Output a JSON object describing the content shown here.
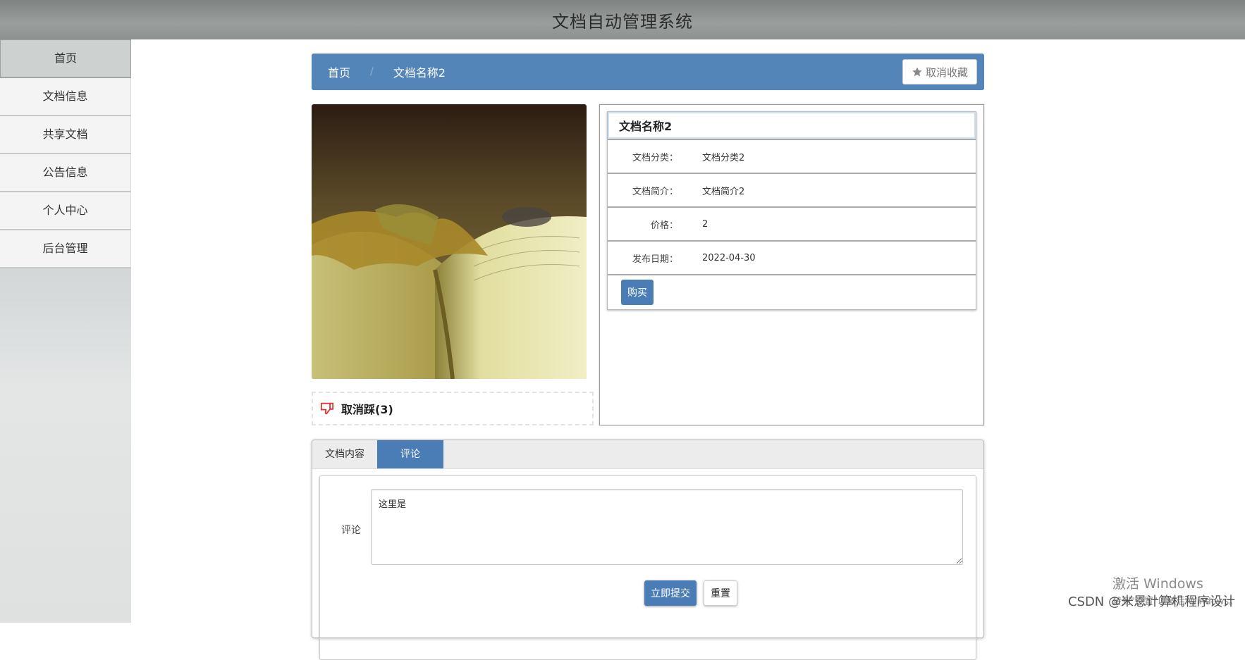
{
  "header": {
    "title": "文档自动管理系统"
  },
  "sidebar": {
    "items": [
      {
        "label": "首页"
      },
      {
        "label": "文档信息"
      },
      {
        "label": "共享文档"
      },
      {
        "label": "公告信息"
      },
      {
        "label": "个人中心"
      },
      {
        "label": "后台管理"
      }
    ]
  },
  "breadcrumb": {
    "home": "首页",
    "separator": "/",
    "current": "文档名称2",
    "unfavorite_label": "取消收藏"
  },
  "dislike": {
    "label": "取消踩(3)"
  },
  "detail": {
    "title": "文档名称2",
    "rows": [
      {
        "key": "文档分类：",
        "value": "文档分类2"
      },
      {
        "key": "文档简介：",
        "value": "文档简介2"
      },
      {
        "key": "价格：",
        "value": "2"
      },
      {
        "key": "发布日期：",
        "value": "2022-04-30"
      }
    ],
    "buy_label": "购买"
  },
  "tabs": [
    {
      "label": "文档内容"
    },
    {
      "label": "评论"
    }
  ],
  "comment_form": {
    "label": "评论",
    "value": "这里是",
    "submit_label": "立即提交",
    "reset_label": "重置"
  },
  "watermarks": {
    "windows_line1": "激活 Windows",
    "windows_line2": "转到\"设置\"以激活 Windows。",
    "csdn": "CSDN @米恩计算机程序设计"
  },
  "colors": {
    "accent": "#4a7db5",
    "breadcrumb_bg": "#5485b9",
    "header_bg": "#8d9190",
    "dislike_icon": "#d9342b"
  },
  "icons": {
    "favorite": "star-icon",
    "dislike": "thumbs-down-icon"
  }
}
